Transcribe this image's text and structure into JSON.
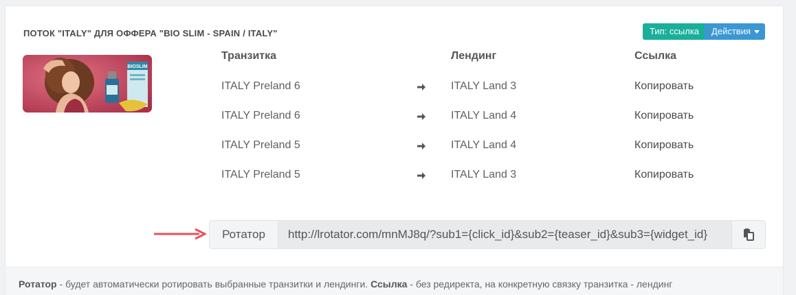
{
  "header": {
    "title": "ПОТОК \"ITALY\" ДЛЯ ОФФЕРА \"BIO SLIM - SPAIN / ITALY\"",
    "type_badge": "Тип: ссылка",
    "actions_label": "Действия"
  },
  "thumbnail": {
    "product_text": "BIOSLIM"
  },
  "table": {
    "columns": [
      "Транзитка",
      "Лендинг",
      "Ссылка"
    ],
    "rows": [
      {
        "prelanding": "ITALY Preland 6",
        "landing": "ITALY Land 3",
        "link": "Копировать"
      },
      {
        "prelanding": "ITALY Preland 6",
        "landing": "ITALY Land 4",
        "link": "Копировать"
      },
      {
        "prelanding": "ITALY Preland 5",
        "landing": "ITALY Land 4",
        "link": "Копировать"
      },
      {
        "prelanding": "ITALY Preland 5",
        "landing": "ITALY Land 3",
        "link": "Копировать"
      }
    ]
  },
  "rotator": {
    "label": "Ротатор",
    "url": "http://lrotator.com/mnMJ8q/?sub1={click_id}&sub2={teaser_id}&sub3={widget_id}"
  },
  "footer": {
    "rotator_term": "Ротатор",
    "rotator_desc": " - будет автоматически ротировать выбранные транзитки и лендинги. ",
    "link_term": "Ссылка",
    "link_desc": " - без редиректа, на конкретную связку транзитка - лендинг"
  },
  "colors": {
    "type_badge": "#1aaf9a",
    "actions_badge": "#3b97d3",
    "pointer_arrow": "#e8505b"
  }
}
